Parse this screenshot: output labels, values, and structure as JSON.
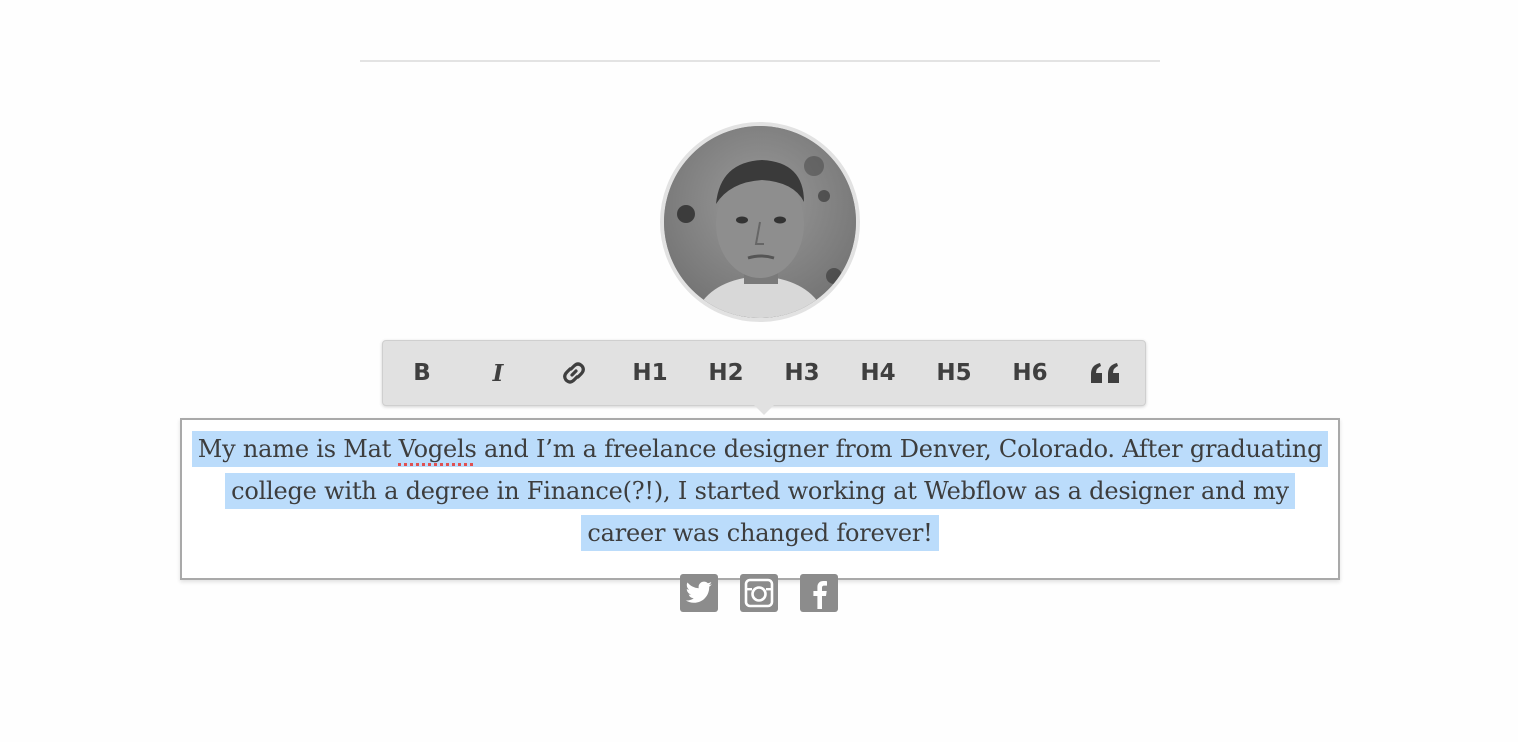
{
  "toolbar": {
    "bold_label": "B",
    "italic_label": "I",
    "h1_label": "H1",
    "h2_label": "H2",
    "h3_label": "H3",
    "h4_label": "H4",
    "h5_label": "H5",
    "h6_label": "H6",
    "icons": {
      "link": "link-icon",
      "quote": "quote-icon"
    }
  },
  "bio": {
    "part_before_name": "My name is Mat ",
    "misspelled_word": "Vogels",
    "part_after_name": " and I’m a freelance designer from Denver, Colorado. After graduating college with a degree in Finance(?!), I started working at Webflow as a designer and my career was changed forever!"
  },
  "social": {
    "icons": [
      "twitter-icon",
      "instagram-icon",
      "facebook-icon"
    ]
  },
  "colors": {
    "selection": "#bbdcfb",
    "toolbar_bg": "#e1e1e1",
    "icon_gray": "#8c8c8c",
    "text": "#3d3d3d"
  }
}
